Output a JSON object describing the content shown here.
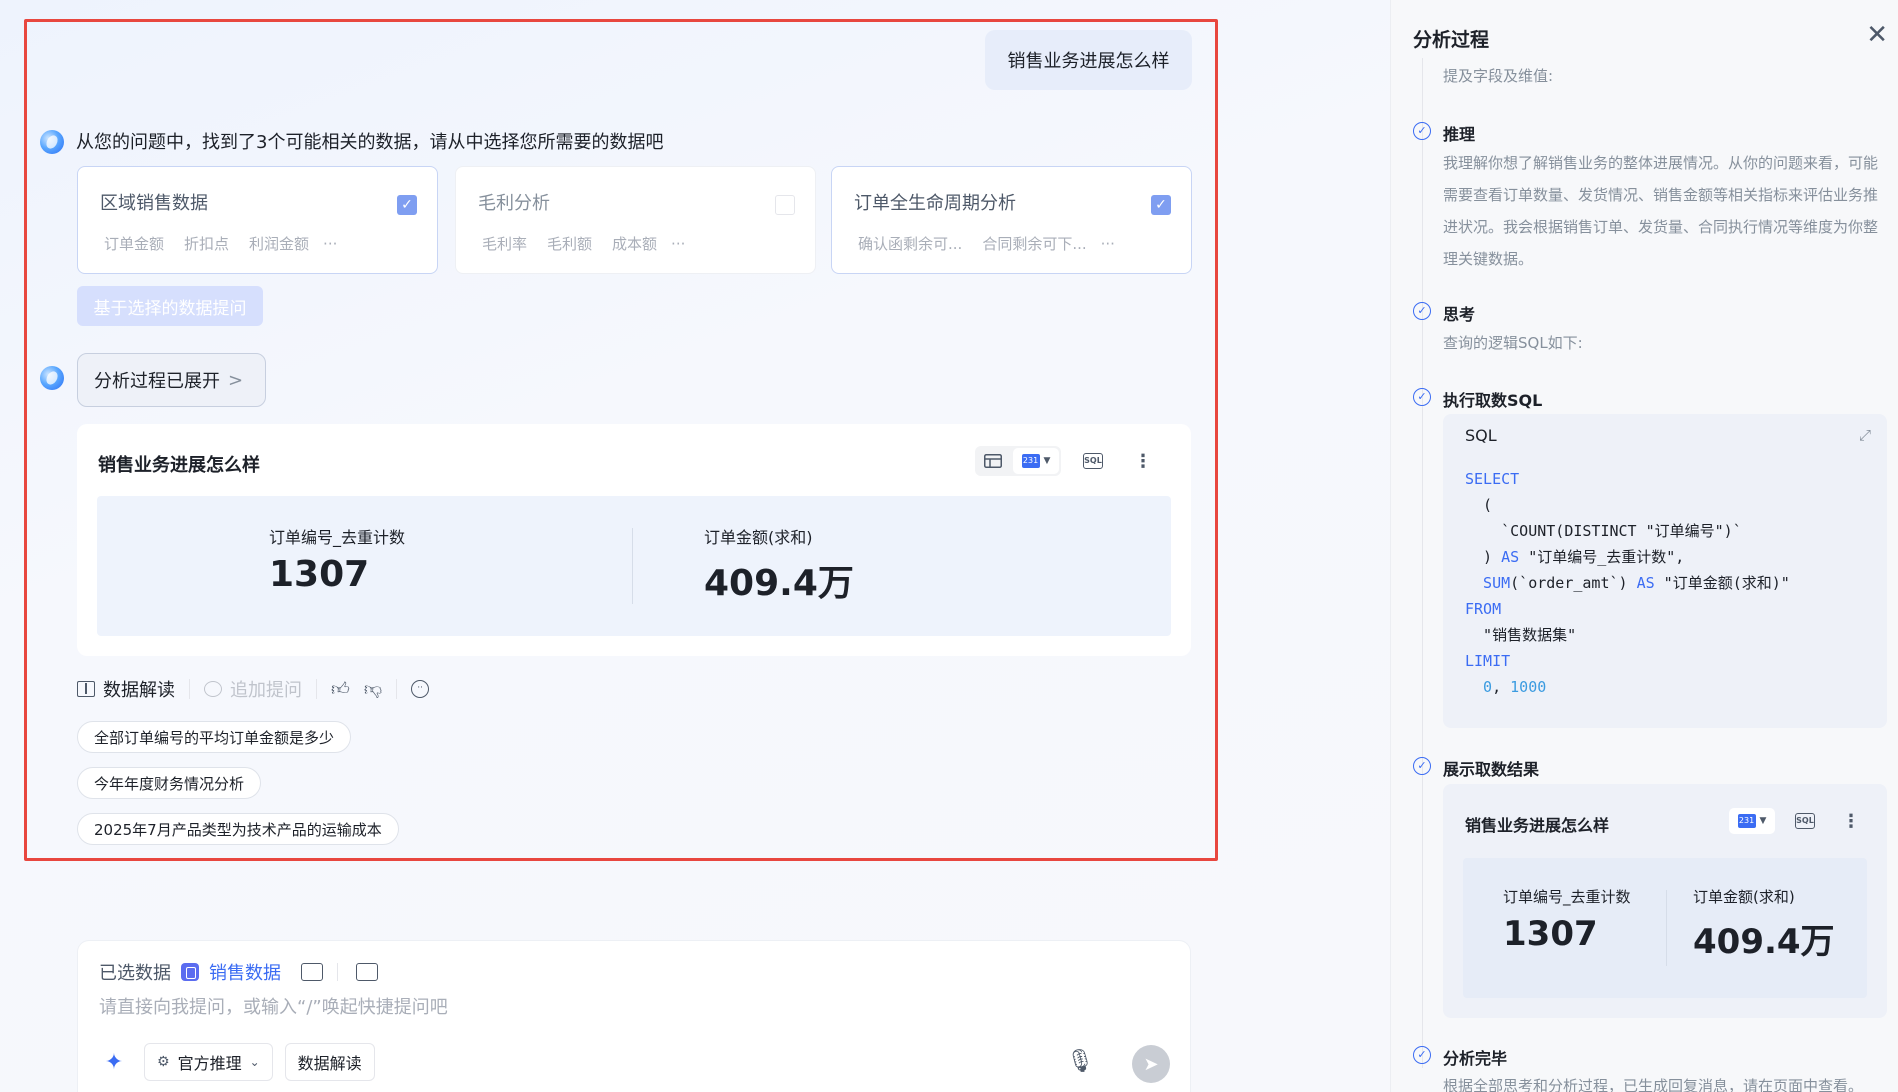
{
  "chat": {
    "user_question": "销售业务进展怎么样",
    "intro": "从您的问题中，找到了3个可能相关的数据，请从中选择您所需要的数据吧",
    "datasets": [
      {
        "title": "区域销售数据",
        "selected": true,
        "tags": [
          "订单金额",
          "折扣点",
          "利润金额"
        ],
        "more": "···"
      },
      {
        "title": "毛利分析",
        "selected": false,
        "tags": [
          "毛利率",
          "毛利额",
          "成本额"
        ],
        "more": "···"
      },
      {
        "title": "订单全生命周期分析",
        "selected": true,
        "tags": [
          "确认函剩余可...",
          "合同剩余可下..."
        ],
        "more": "···"
      }
    ],
    "ask_button": "基于选择的数据提问",
    "analysis_toggle": "分析过程已展开",
    "analysis_chevron": ">",
    "result": {
      "title": "销售业务进展怎么样",
      "kpis": [
        {
          "label": "订单编号_去重计数",
          "value": "1307"
        },
        {
          "label": "订单金额(求和)",
          "value": "409.4万"
        }
      ]
    },
    "actions": {
      "interpret": "数据解读",
      "follow_up": "追加提问"
    },
    "suggestions": [
      "全部订单编号的平均订单金额是多少",
      "今年年度财务情况分析",
      "2025年7月产品类型为技术产品的运输成本"
    ]
  },
  "input": {
    "selected_label": "已选数据",
    "dataset_name": "销售数据",
    "placeholder": "请直接向我提问，或输入“/”唤起快捷提问吧",
    "chip_reasoning": "官方推理",
    "chip_interpret": "数据解读"
  },
  "panel": {
    "title": "分析过程",
    "fields_desc": "提及字段及维值:",
    "steps": [
      {
        "title": "推理",
        "desc": "我理解你想了解销售业务的整体进展情况。从你的问题来看，可能需要查看订单数量、发货情况、销售金额等相关指标来评估业务推进状况。我会根据销售订单、发货量、合同执行情况等维度为你整理关键数据。"
      },
      {
        "title": "思考",
        "desc": "查询的逻辑SQL如下:"
      },
      {
        "title": "执行取数SQL"
      },
      {
        "title": "展示取数结果"
      },
      {
        "title": "分析完毕",
        "desc": "根据全部思考和分析过程，已生成回复消息，请在页面中查看。"
      }
    ],
    "sql": {
      "label": "SQL",
      "code": {
        "l1_kw": "SELECT",
        "l2": "  (",
        "l3": "    `COUNT(DISTINCT \"订单编号\")`",
        "l4_a": "  ) ",
        "l4_kw": "AS",
        "l4_b": " \"订单编号_去重计数\",",
        "l5_kw1": "  SUM",
        "l5_a": "(`order_amt`) ",
        "l5_kw2": "AS",
        "l5_b": " \"订单金额(求和)\"",
        "l6_kw": "FROM",
        "l7": "  \"销售数据集\"",
        "l8_kw": "LIMIT",
        "l9_n1": "  0",
        "l9_sep": ", ",
        "l9_n2": "1000"
      }
    },
    "mini_result": {
      "title": "销售业务进展怎么样",
      "kpis": [
        {
          "label": "订单编号_去重计数",
          "value": "1307"
        },
        {
          "label": "订单金额(求和)",
          "value": "409.4万"
        }
      ]
    }
  },
  "colors": {
    "accent": "#3b6cf3",
    "highlight_frame": "#e8473f"
  }
}
